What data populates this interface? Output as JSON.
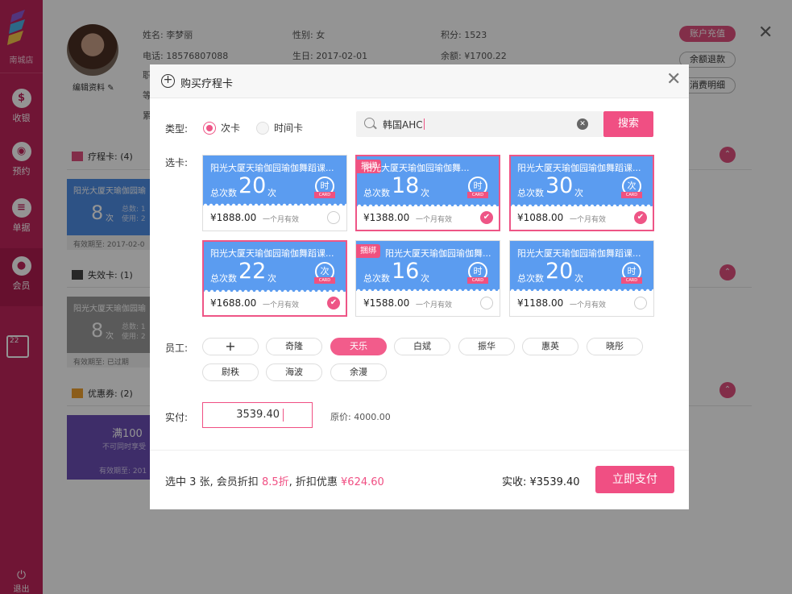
{
  "sidebar": {
    "store": "南城店",
    "items": [
      {
        "label": "收银",
        "icon": "money-bag-icon",
        "glyph": "$"
      },
      {
        "label": "预约",
        "icon": "camera-icon",
        "glyph": "◉"
      },
      {
        "label": "单据",
        "icon": "document-icon",
        "glyph": "≡"
      },
      {
        "label": "会员",
        "icon": "member-icon",
        "glyph": "●"
      }
    ],
    "calendar_day": "22",
    "logout": "退出"
  },
  "member": {
    "edit_label": "编辑资料",
    "name": "姓名: 李梦丽",
    "gender": "性别: 女",
    "points": "积分: 1523",
    "phone": "电话: 18576807088",
    "birthday": "生日: 2017-02-01",
    "balance": "余额: ¥1700.22",
    "partial1": "职",
    "partial2": "等",
    "partial3": "累",
    "recharge": "账户充值",
    "refund": "余额退款",
    "details": "消费明细"
  },
  "sections": {
    "course_cards": "疗程卡: (4)",
    "invalid_cards": "失效卡: (1)",
    "coupons": "优惠券: (2)"
  },
  "bg_cards": {
    "card1_name": "阳光大厦天瑜伽园瑜",
    "card1_num": "8",
    "card1_unit": "次",
    "card1_meta1": "总数: 1",
    "card1_meta2": "使用: 2",
    "card1_foot": "有效期至: 2017-02-0",
    "card2_name": "阳光大厦天瑜伽园瑜",
    "card2_num": "8",
    "card2_unit": "次",
    "card2_meta1": "总数: 1",
    "card2_meta2": "使用: 2",
    "card2_foot": "有效期至: 已过期",
    "coupon_title": "满100",
    "coupon_sub": "不可同时享受",
    "coupon_foot": "有效期至: 201"
  },
  "modal": {
    "title": "购买疗程卡",
    "type_label": "类型:",
    "type_options": [
      "次卡",
      "时间卡"
    ],
    "search_value": "韩国AHC",
    "search_btn": "搜索",
    "select_label": "选卡:",
    "count_label": "总次数",
    "cards": [
      {
        "name": "阳光大厦天瑜伽园瑜伽舞蹈课...",
        "tag": "",
        "count": "20",
        "unit": "次",
        "badge": "时",
        "badge_sub": "CARD",
        "price": "¥1888.00",
        "valid": "一个月有效",
        "selected": false
      },
      {
        "name": "阳光大厦天瑜伽园瑜伽舞...",
        "tag": "捆绑",
        "count": "18",
        "unit": "次",
        "badge": "时",
        "badge_sub": "CARD",
        "price": "¥1388.00",
        "valid": "一个月有效",
        "selected": true
      },
      {
        "name": "阳光大厦天瑜伽园瑜伽舞蹈课...",
        "tag": "",
        "count": "30",
        "unit": "次",
        "badge": "次",
        "badge_sub": "CARD",
        "price": "¥1088.00",
        "valid": "一个月有效",
        "selected": true
      },
      {
        "name": "阳光大厦天瑜伽园瑜伽舞蹈课...",
        "tag": "",
        "count": "22",
        "unit": "次",
        "badge": "次",
        "badge_sub": "CARD",
        "price": "¥1688.00",
        "valid": "一个月有效",
        "selected": true
      },
      {
        "name": "阳光大厦天瑜伽园瑜伽舞...",
        "tag": "捆绑",
        "count": "16",
        "unit": "次",
        "badge": "时",
        "badge_sub": "CARD",
        "price": "¥1588.00",
        "valid": "一个月有效",
        "selected": false
      },
      {
        "name": "阳光大厦天瑜伽园瑜伽舞蹈课...",
        "tag": "",
        "count": "20",
        "unit": "次",
        "badge": "时",
        "badge_sub": "CARD",
        "price": "¥1188.00",
        "valid": "一个月有效",
        "selected": false
      }
    ],
    "staff_label": "员工:",
    "staff_add": "+",
    "staff": [
      {
        "name": "奇隆",
        "selected": false
      },
      {
        "name": "天乐",
        "selected": true
      },
      {
        "name": "白斌",
        "selected": false
      },
      {
        "name": "振华",
        "selected": false
      },
      {
        "name": "惠英",
        "selected": false
      },
      {
        "name": "晓彤",
        "selected": false
      },
      {
        "name": "尉秩",
        "selected": false
      },
      {
        "name": "海波",
        "selected": false
      },
      {
        "name": "余漫",
        "selected": false
      }
    ],
    "pay_label": "实付:",
    "pay_value": "3539.40",
    "original_price": "原价: 4000.00",
    "summary_prefix": "选中 3 张, 会员折扣 ",
    "discount": "8.5折",
    "summary_mid": ", 折扣优惠 ",
    "discount_amount": "¥624.60",
    "total": "实收: ¥3539.40",
    "pay_btn": "立即支付"
  },
  "colors": {
    "accent": "#f04f83",
    "sidebar": "#c2255c",
    "card_blue": "#5b9cf0"
  }
}
